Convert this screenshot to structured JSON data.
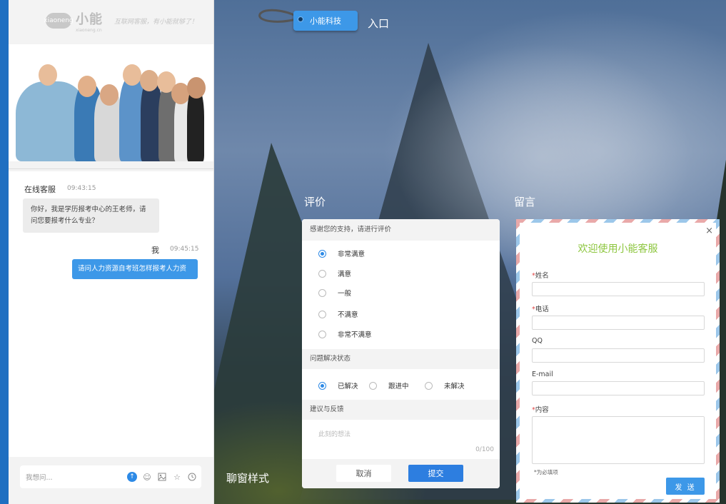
{
  "brand": {
    "logo_mark": "xiaoneng",
    "logo_text": "小能",
    "logo_sub": "xiaoneng.cn",
    "slogan": "互联网客服，有小能就够了！"
  },
  "header": {
    "company_tag": "小能科技",
    "entry_label": "入口"
  },
  "chat": {
    "agent_name": "在线客服",
    "agent_time": "09:43:15",
    "agent_message": "你好，我是学历报考中心的王老师，请问您要报考什么专业？",
    "user_name": "我",
    "user_time": "09:45:15",
    "user_message": "请问人力资源自考班怎样报考人力资",
    "input_placeholder": "我想问..."
  },
  "toolbar_icons": [
    "send-icon",
    "emoji-icon",
    "image-icon",
    "star-icon",
    "history-icon"
  ],
  "sections": {
    "rating_label": "评价",
    "message_label": "留言",
    "style_label": "聊窗样式"
  },
  "rating": {
    "prompt": "感谢您的支持，请进行评价",
    "options": [
      "非常满意",
      "满意",
      "一般",
      "不满意",
      "非常不满意"
    ],
    "selected_option": "非常满意",
    "status_title": "问题解决状态",
    "status_options": [
      "已解决",
      "跟进中",
      "未解决"
    ],
    "selected_status": "已解决",
    "feedback_title": "建议与反馈",
    "feedback_placeholder": "此刻的想法",
    "char_count": "0/100",
    "cancel": "取消",
    "submit": "提交"
  },
  "leave_message": {
    "title": "欢迎使用小能客服",
    "close": "×",
    "fields": [
      {
        "label": "姓名",
        "required": true
      },
      {
        "label": "电话",
        "required": true
      },
      {
        "label": "QQ",
        "required": false
      },
      {
        "label": "E-mail",
        "required": false
      },
      {
        "label": "内容",
        "required": true
      }
    ],
    "required_mark": "*",
    "required_note": "*为必填项",
    "send": "发 送"
  },
  "colors": {
    "accent_blue": "#3d98e8",
    "left_bar": "#1f6fc1",
    "title_green": "#8dc63f",
    "required_red": "#e04545"
  }
}
